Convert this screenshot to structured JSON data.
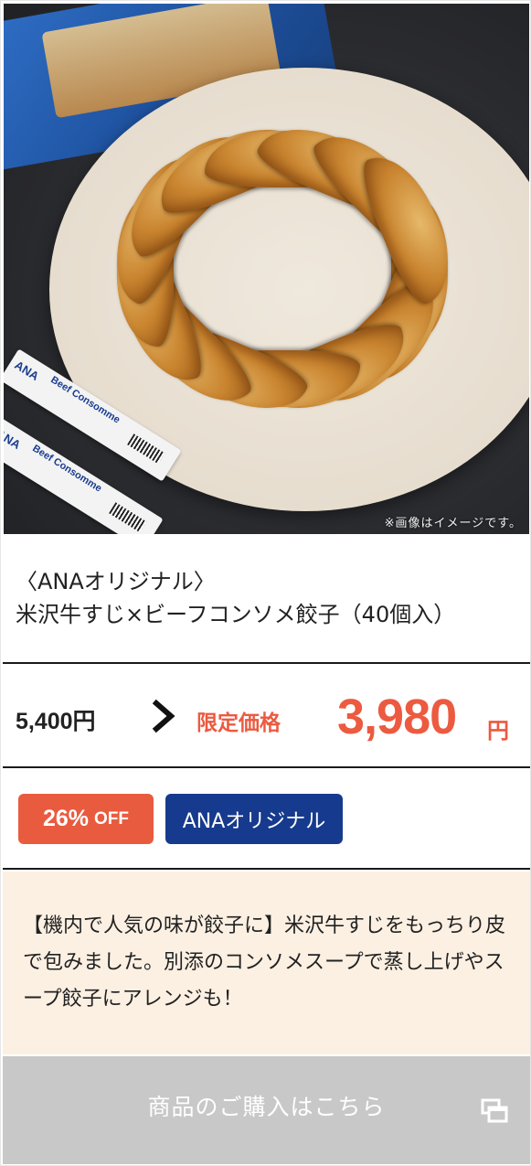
{
  "image": {
    "alt_note": "※画像はイメージです。",
    "stick_brand": "ANA",
    "stick_label": "Beef Consomme"
  },
  "product": {
    "title_line1": "〈ANAオリジナル〉",
    "title_line2": "米沢牛すじ×ビーフコンソメ餃子（40個入）"
  },
  "price": {
    "original": "5,400円",
    "limited_label": "限定価格",
    "sale_value": "3,980",
    "sale_unit": "円"
  },
  "badges": {
    "discount_percent": "26%",
    "discount_off": "OFF",
    "brand": "ANAオリジナル"
  },
  "description": "【機内で人気の味が餃子に】米沢牛すじをもっちり皮で包みました。別添のコンソメスープで蒸し上げやスープ餃子にアレンジも！",
  "cta": {
    "label": "商品のご購入はこちら"
  },
  "colors": {
    "accent_red": "#ec5a40",
    "badge_navy": "#163a8d",
    "desc_bg": "#fcf0e3",
    "cta_bg": "#c8c8c8"
  },
  "icons": {
    "arrow": "chevron-right-icon",
    "external": "external-window-icon"
  }
}
